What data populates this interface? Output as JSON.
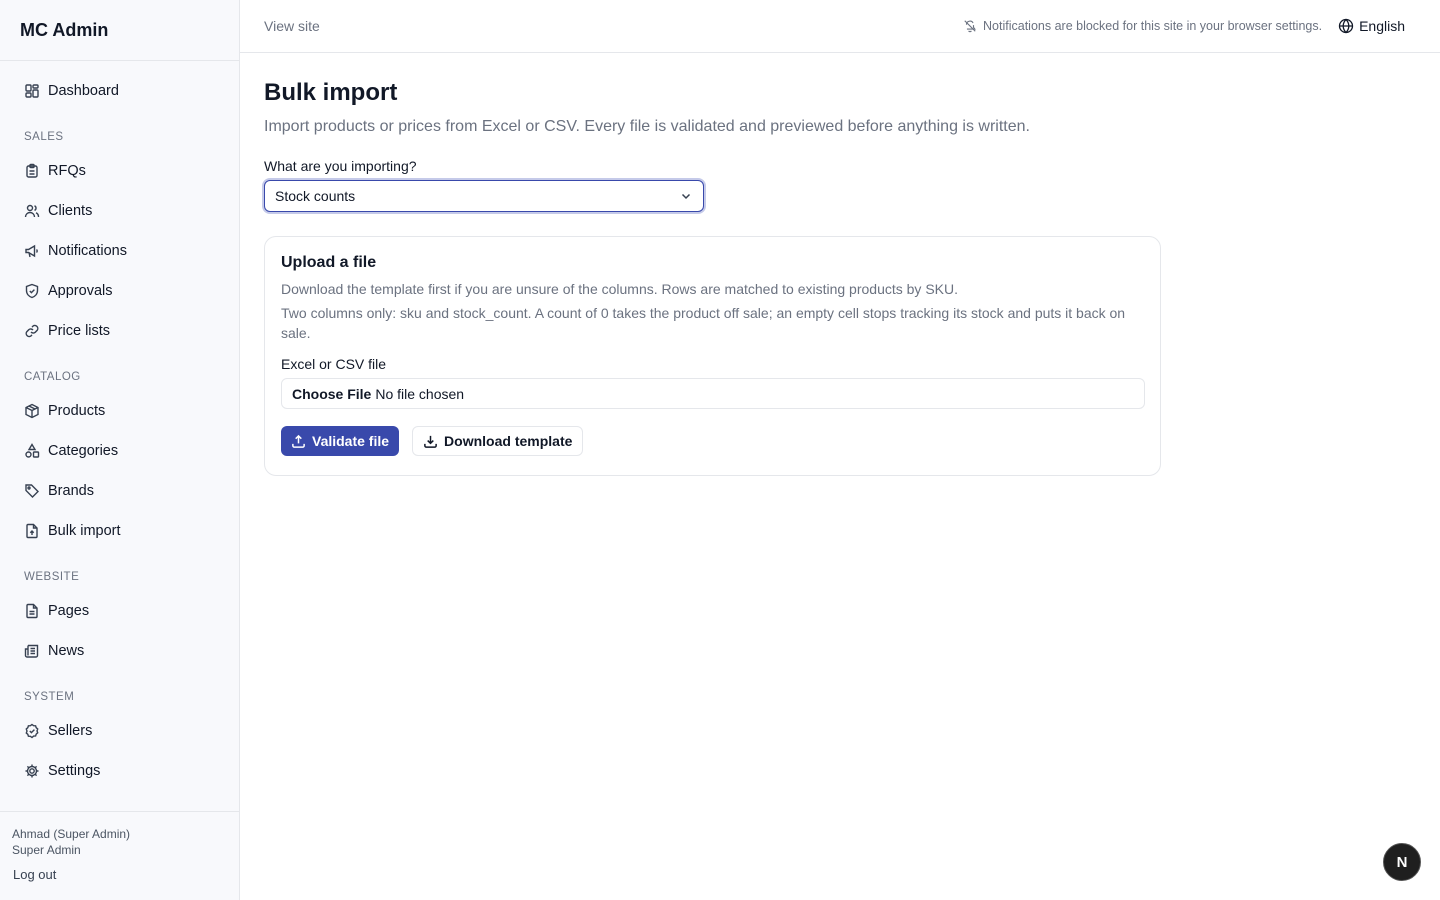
{
  "app": {
    "title": "MC Admin"
  },
  "sidebar": {
    "dashboard": {
      "label": "Dashboard",
      "icon": "dashboard-icon"
    },
    "sections": [
      {
        "label": "SALES",
        "items": [
          {
            "label": "RFQs",
            "icon": "clipboard-icon"
          },
          {
            "label": "Clients",
            "icon": "users-icon"
          },
          {
            "label": "Notifications",
            "icon": "megaphone-icon"
          },
          {
            "label": "Approvals",
            "icon": "shield-check-icon"
          },
          {
            "label": "Price lists",
            "icon": "link-icon"
          }
        ]
      },
      {
        "label": "CATALOG",
        "items": [
          {
            "label": "Products",
            "icon": "package-icon"
          },
          {
            "label": "Categories",
            "icon": "shapes-icon"
          },
          {
            "label": "Brands",
            "icon": "tag-icon"
          },
          {
            "label": "Bulk import",
            "icon": "file-upload-icon"
          }
        ]
      },
      {
        "label": "WEBSITE",
        "items": [
          {
            "label": "Pages",
            "icon": "file-text-icon"
          },
          {
            "label": "News",
            "icon": "newspaper-icon"
          }
        ]
      },
      {
        "label": "SYSTEM",
        "items": [
          {
            "label": "Sellers",
            "icon": "badge-check-icon"
          },
          {
            "label": "Settings",
            "icon": "gear-icon"
          }
        ]
      }
    ],
    "footer": {
      "user_name": "Ahmad (Super Admin)",
      "user_role": "Super Admin",
      "logout_label": "Log out"
    }
  },
  "topbar": {
    "view_site": "View site",
    "notification_notice": "Notifications are blocked for this site in your browser settings.",
    "language": "English"
  },
  "main": {
    "title": "Bulk import",
    "subtitle": "Import products or prices from Excel or CSV. Every file is validated and previewed before anything is written.",
    "import_type_label": "What are you importing?",
    "import_type_value": "Stock counts",
    "card": {
      "title": "Upload a file",
      "description": "Download the template first if you are unsure of the columns. Rows are matched to existing products by SKU.",
      "note": "Two columns only: sku and stock_count. A count of 0 takes the product off sale; an empty cell stops tracking its stock and puts it back on sale.",
      "file_label": "Excel or CSV file",
      "file_button": "Choose File",
      "file_status": "No file chosen",
      "validate_label": "Validate file",
      "download_label": "Download template"
    }
  },
  "badge": {
    "letter": "N"
  },
  "colors": {
    "accent": "#3949ab",
    "sidebar_bg": "#f8f9fc",
    "border": "#e5e7eb"
  }
}
